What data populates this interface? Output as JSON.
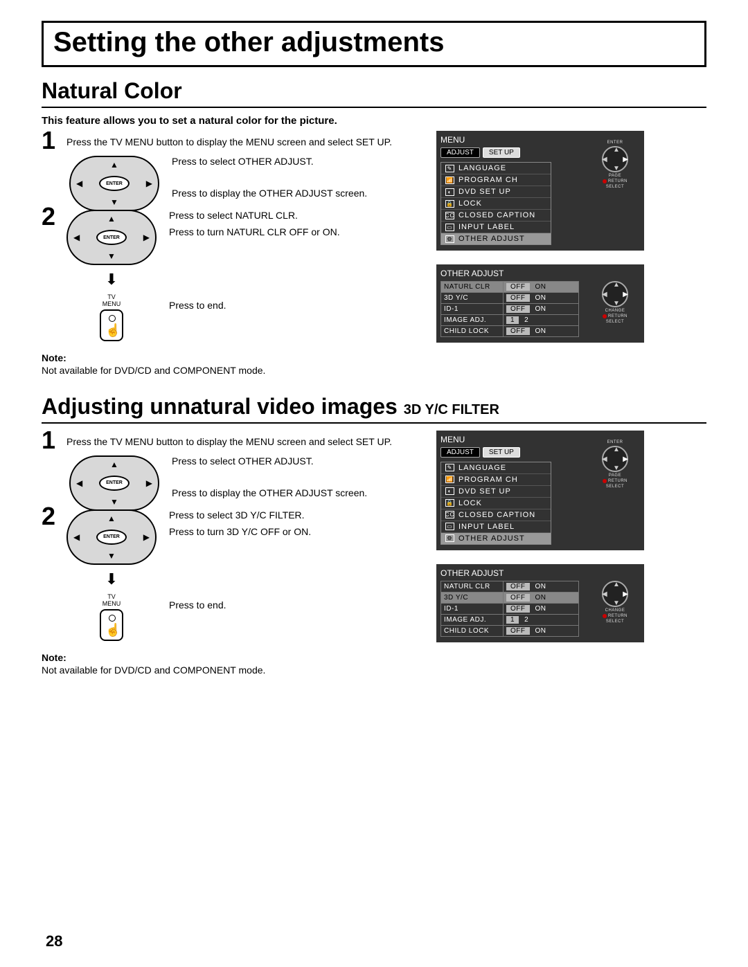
{
  "page_title": "Setting the other adjustments",
  "page_number": "28",
  "section1": {
    "title": "Natural Color",
    "intro": "This feature allows you to set a natural color for the picture.",
    "step1": {
      "num": "1",
      "text": "Press the TV MENU button to display the MENU screen and select SET UP."
    },
    "instr1": "Press to select OTHER ADJUST.",
    "instr2": "Press to display the OTHER ADJUST screen.",
    "step2": {
      "num": "2"
    },
    "instr3": "Press to select NATURL CLR.",
    "instr4": "Press to turn NATURL CLR OFF or ON.",
    "instr5": "Press to end.",
    "tv_menu_label": "TV\nMENU",
    "enter": "ENTER",
    "note_label": "Note:",
    "note_text": "Not available for DVD/CD and COMPONENT mode."
  },
  "section2": {
    "title_main": "Adjusting unnatural video images ",
    "title_sub": "3D Y/C FILTER",
    "step1": {
      "num": "1",
      "text": "Press the TV MENU button to display the MENU screen and select SET UP."
    },
    "instr1": "Press to select OTHER ADJUST.",
    "instr2": "Press to display the OTHER ADJUST screen.",
    "step2": {
      "num": "2"
    },
    "instr3": "Press to select 3D Y/C FILTER.",
    "instr4": "Press to turn 3D Y/C OFF or ON.",
    "instr5": "Press to end.",
    "tv_menu_label": "TV\nMENU",
    "enter": "ENTER",
    "note_label": "Note:",
    "note_text": "Not available for DVD/CD and COMPONENT mode."
  },
  "osd_menu": {
    "title": "MENU",
    "tabs": [
      "ADJUST",
      "SET UP"
    ],
    "items": [
      "LANGUAGE",
      "PROGRAM CH",
      "DVD SET UP",
      "LOCK",
      "CLOSED CAPTION",
      "INPUT LABEL",
      "OTHER ADJUST"
    ],
    "hints": {
      "enter": "ENTER",
      "page": "PAGE",
      "return": "RETURN",
      "select": "SELECT"
    }
  },
  "osd_other": {
    "title": "OTHER ADJUST",
    "rows": [
      {
        "label": "NATURL CLR",
        "opts": [
          "OFF",
          "ON"
        ],
        "sel": 0
      },
      {
        "label": "3D Y/C",
        "opts": [
          "OFF",
          "ON"
        ],
        "sel": 0
      },
      {
        "label": "ID-1",
        "opts": [
          "OFF",
          "ON"
        ],
        "sel": 0
      },
      {
        "label": "IMAGE ADJ.",
        "opts": [
          "1",
          "2"
        ],
        "sel": 0
      },
      {
        "label": "CHILD LOCK",
        "opts": [
          "OFF",
          "ON"
        ],
        "sel": 0
      }
    ],
    "hints": {
      "change": "CHANGE",
      "return": "RETURN",
      "select": "SELECT"
    }
  },
  "highlighted_row": {
    "sec1": 0,
    "sec2": 1
  }
}
